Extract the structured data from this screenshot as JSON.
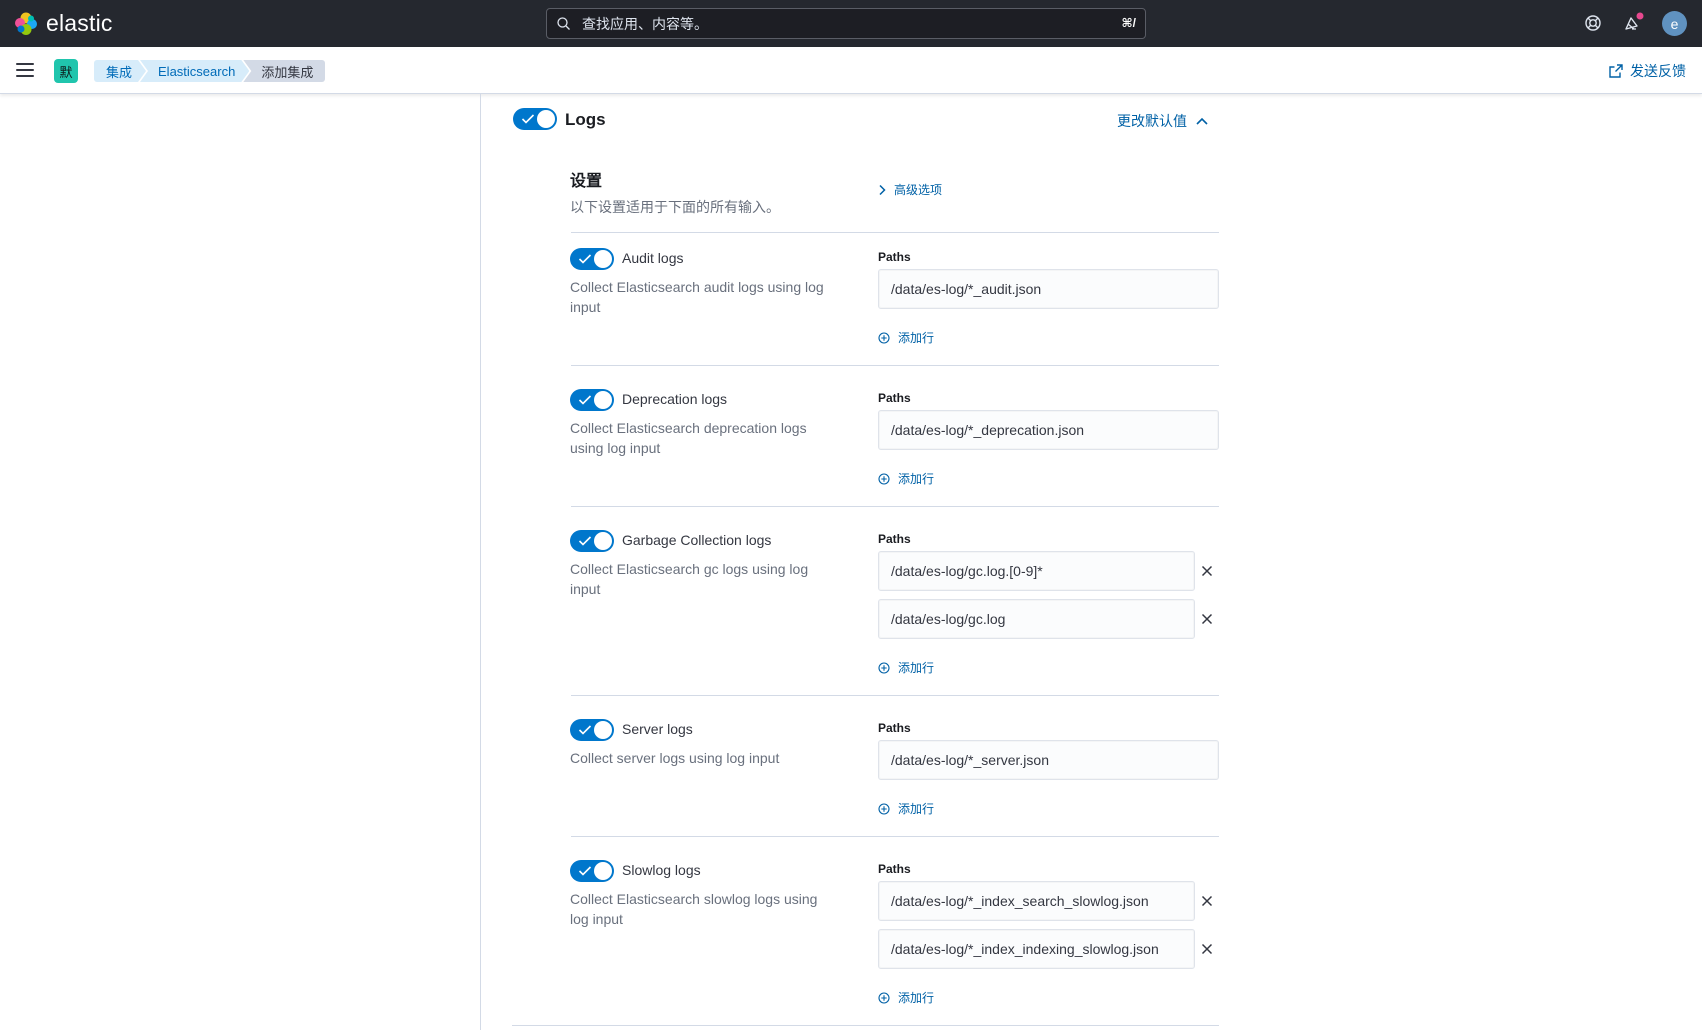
{
  "app": {
    "brand": "elastic"
  },
  "header": {
    "search_placeholder": "查找应用、内容等。",
    "search_shortcut": "⌘/",
    "avatar_initial": "e",
    "colors": {
      "bg": "#25282f",
      "avatar": "#6092c0",
      "notification_dot": "#e7488f"
    }
  },
  "breadcrumbs": {
    "space_badge": "默",
    "items": [
      "集成",
      "Elasticsearch",
      "添加集成"
    ]
  },
  "feedback_label": "发送反馈",
  "logs_section": {
    "title": "Logs",
    "enabled": true,
    "change_defaults_label": "更改默认值",
    "settings_title": "设置",
    "settings_desc": "以下设置适用于下面的所有输入。",
    "advanced_label": "高级选项",
    "add_row_label": "添加行",
    "paths_label": "Paths",
    "inputs": [
      {
        "title": "Audit logs",
        "enabled": true,
        "desc_line1": "Collect Elasticsearch audit logs using log",
        "desc_line2": "input",
        "paths": [
          "/data/es-log/*_audit.json"
        ]
      },
      {
        "title": "Deprecation logs",
        "enabled": true,
        "desc_line1": "Collect Elasticsearch deprecation logs",
        "desc_line2": "using log input",
        "paths": [
          "/data/es-log/*_deprecation.json"
        ]
      },
      {
        "title": "Garbage Collection logs",
        "enabled": true,
        "desc_line1": "Collect Elasticsearch gc logs using log",
        "desc_line2": "input",
        "paths": [
          "/data/es-log/gc.log.[0-9]*",
          "/data/es-log/gc.log"
        ]
      },
      {
        "title": "Server logs",
        "enabled": true,
        "desc_line1": "Collect server logs using log input",
        "desc_line2": "",
        "paths": [
          "/data/es-log/*_server.json"
        ]
      },
      {
        "title": "Slowlog logs",
        "enabled": true,
        "desc_line1": "Collect Elasticsearch slowlog logs using",
        "desc_line2": "log input",
        "paths": [
          "/data/es-log/*_index_search_slowlog.json",
          "/data/es-log/*_index_indexing_slowlog.json"
        ]
      }
    ]
  },
  "accent_color": "#0077cc",
  "link_color": "#0061a6"
}
